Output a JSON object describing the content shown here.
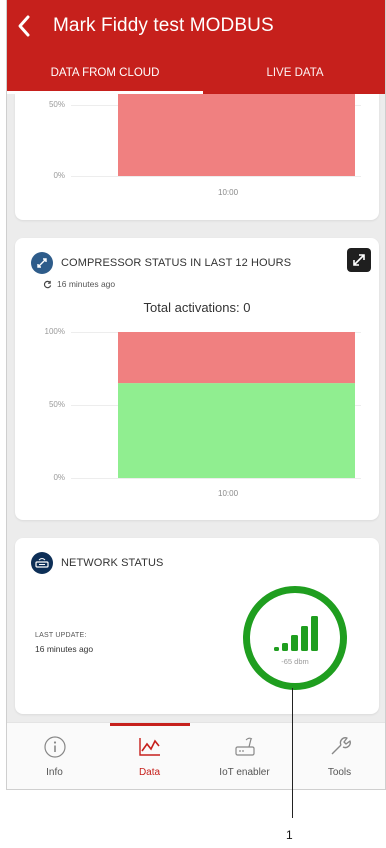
{
  "header": {
    "title": "Mark Fiddy test MODBUS"
  },
  "tabs": [
    {
      "label": "DATA FROM CLOUD",
      "active": true
    },
    {
      "label": "LIVE DATA",
      "active": false
    }
  ],
  "chart_top": {
    "yticks": [
      "50%",
      "0%"
    ],
    "xtick": "10:00"
  },
  "compressor": {
    "title": "COMPRESSOR STATUS IN LAST 12 HOURS",
    "updated": "16 minutes ago",
    "activations": "Total activations: 0",
    "yticks": [
      "100%",
      "50%",
      "0%"
    ],
    "xtick": "10:00"
  },
  "network": {
    "title": "NETWORK STATUS",
    "last_update_label": "LAST UPDATE:",
    "last_update_value": "16 minutes ago",
    "signal_text": "-65 dbm"
  },
  "nav": [
    {
      "label": "Info",
      "active": false
    },
    {
      "label": "Data",
      "active": true
    },
    {
      "label": "IoT enabler",
      "active": false
    },
    {
      "label": "Tools",
      "active": false
    }
  ],
  "annotation": {
    "callout": "1"
  },
  "chart_data": [
    {
      "type": "bar",
      "categories": [
        "10:00"
      ],
      "series": [
        {
          "values": [
            100
          ],
          "color": "#f08080"
        }
      ],
      "ylim": [
        0,
        100
      ],
      "ytick_labels": [
        "50%",
        "0%"
      ]
    },
    {
      "type": "bar",
      "title": "COMPRESSOR STATUS IN LAST 12 HOURS",
      "categories": [
        "10:00"
      ],
      "stacked": true,
      "series": [
        {
          "values": [
            65
          ],
          "color": "#90ee90"
        },
        {
          "values": [
            35
          ],
          "color": "#f08080"
        }
      ],
      "ylim": [
        0,
        100
      ],
      "ytick_labels": [
        "100%",
        "50%",
        "0%"
      ]
    }
  ],
  "colors": {
    "brand": "#c6201c",
    "ok": "#1f9e1f",
    "bar_red": "#f08080",
    "bar_green": "#90ee90"
  }
}
